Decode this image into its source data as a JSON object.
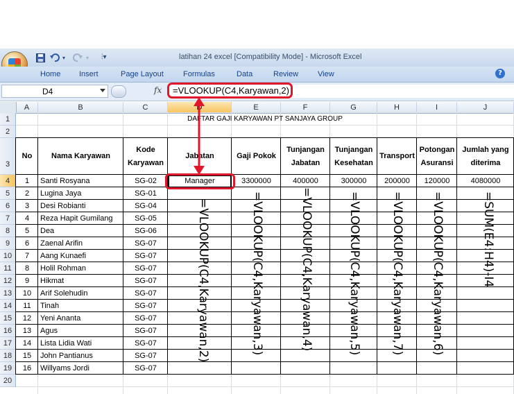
{
  "app": {
    "window_title": "latihan 24 excel  [Compatibility Mode] - Microsoft Excel",
    "quick_access": [
      "save-icon",
      "undo-icon",
      "redo-icon",
      "customize-icon"
    ]
  },
  "ribbon": {
    "tabs": [
      "Home",
      "Insert",
      "Page Layout",
      "Formulas",
      "Data",
      "Review",
      "View"
    ]
  },
  "formula_bar": {
    "name_box": "D4",
    "fx_label": "fx",
    "formula": "=VLOOKUP(C4,Karyawan,2)"
  },
  "sheet": {
    "columns": [
      "A",
      "B",
      "C",
      "D",
      "E",
      "F",
      "G",
      "H",
      "I",
      "J"
    ],
    "rows": [
      "1",
      "2",
      "3",
      "4",
      "5",
      "6",
      "7",
      "8",
      "9",
      "10",
      "11",
      "12",
      "13",
      "14",
      "15",
      "16",
      "17",
      "18",
      "19",
      "20"
    ],
    "title": "DAFTAR GAJI KARYAWAN PT SANJAYA GROUP",
    "headers": {
      "no": "No",
      "nama": "Nama Karyawan",
      "kode": [
        "Kode",
        "Karyawan"
      ],
      "jabatan": "Jabatan",
      "gaji": "Gaji Pokok",
      "tunj_jabatan": [
        "Tunjangan",
        "Jabatan"
      ],
      "tunj_kesehatan": [
        "Tunjangan",
        "Kesehatan"
      ],
      "transport": "Transport",
      "asuransi": [
        "Potongan",
        "Asuransi"
      ],
      "jumlah": [
        "Jumlah yang",
        "diterima"
      ]
    },
    "employees": [
      {
        "no": "1",
        "nama": "Santi Rosyana",
        "kode": "SG-02"
      },
      {
        "no": "2",
        "nama": "Lugina Jaya",
        "kode": "SG-01"
      },
      {
        "no": "3",
        "nama": "Desi Robianti",
        "kode": "SG-04"
      },
      {
        "no": "4",
        "nama": "Reza Hapit Gumilang",
        "kode": "SG-05"
      },
      {
        "no": "5",
        "nama": "Dea",
        "kode": "SG-06"
      },
      {
        "no": "6",
        "nama": "Zaenal Arifin",
        "kode": "SG-07"
      },
      {
        "no": "7",
        "nama": "Aang Kunaefi",
        "kode": "SG-07"
      },
      {
        "no": "8",
        "nama": "Holil Rohman",
        "kode": "SG-07"
      },
      {
        "no": "9",
        "nama": "Hikmat",
        "kode": "SG-07"
      },
      {
        "no": "10",
        "nama": "Arif Solehudin",
        "kode": "SG-07"
      },
      {
        "no": "11",
        "nama": "Tinah",
        "kode": "SG-07"
      },
      {
        "no": "12",
        "nama": "Yeni Ananta",
        "kode": "SG-07"
      },
      {
        "no": "13",
        "nama": "Agus",
        "kode": "SG-07"
      },
      {
        "no": "14",
        "nama": "Lista Lidia Wati",
        "kode": "SG-07"
      },
      {
        "no": "15",
        "nama": "John Pantianus",
        "kode": "SG-07"
      },
      {
        "no": "16",
        "nama": "Willyams Jordi",
        "kode": "SG-07"
      }
    ],
    "row4_values": {
      "jabatan": "Manager",
      "gaji": "3300000",
      "tunj_jabatan": "400000",
      "tunj_kesehatan": "300000",
      "transport": "200000",
      "asuransi": "120000",
      "jumlah": "4080000"
    }
  },
  "annotations": {
    "jabatan": "=VLOOKUP(C4,Karyawan,2)",
    "gaji": "=VLOOKUP(C4,Karyawan,3)",
    "tunj_jabatan": "=VLOOKUP(C4,Karyawan,4)",
    "tunj_kesehatan": "=VLOOKUP(C4,Karyawan,5)",
    "transport": "=VLOOKUP(C4,Karyawan,7)",
    "asuransi": "=VLOOKUP(C4,Karyawan,6)",
    "jumlah": "=SUM(E4:H4)-I4"
  },
  "colors": {
    "highlight": "#e0162b",
    "selected_header": "#f7c35c",
    "ribbon_text": "#15428b"
  }
}
